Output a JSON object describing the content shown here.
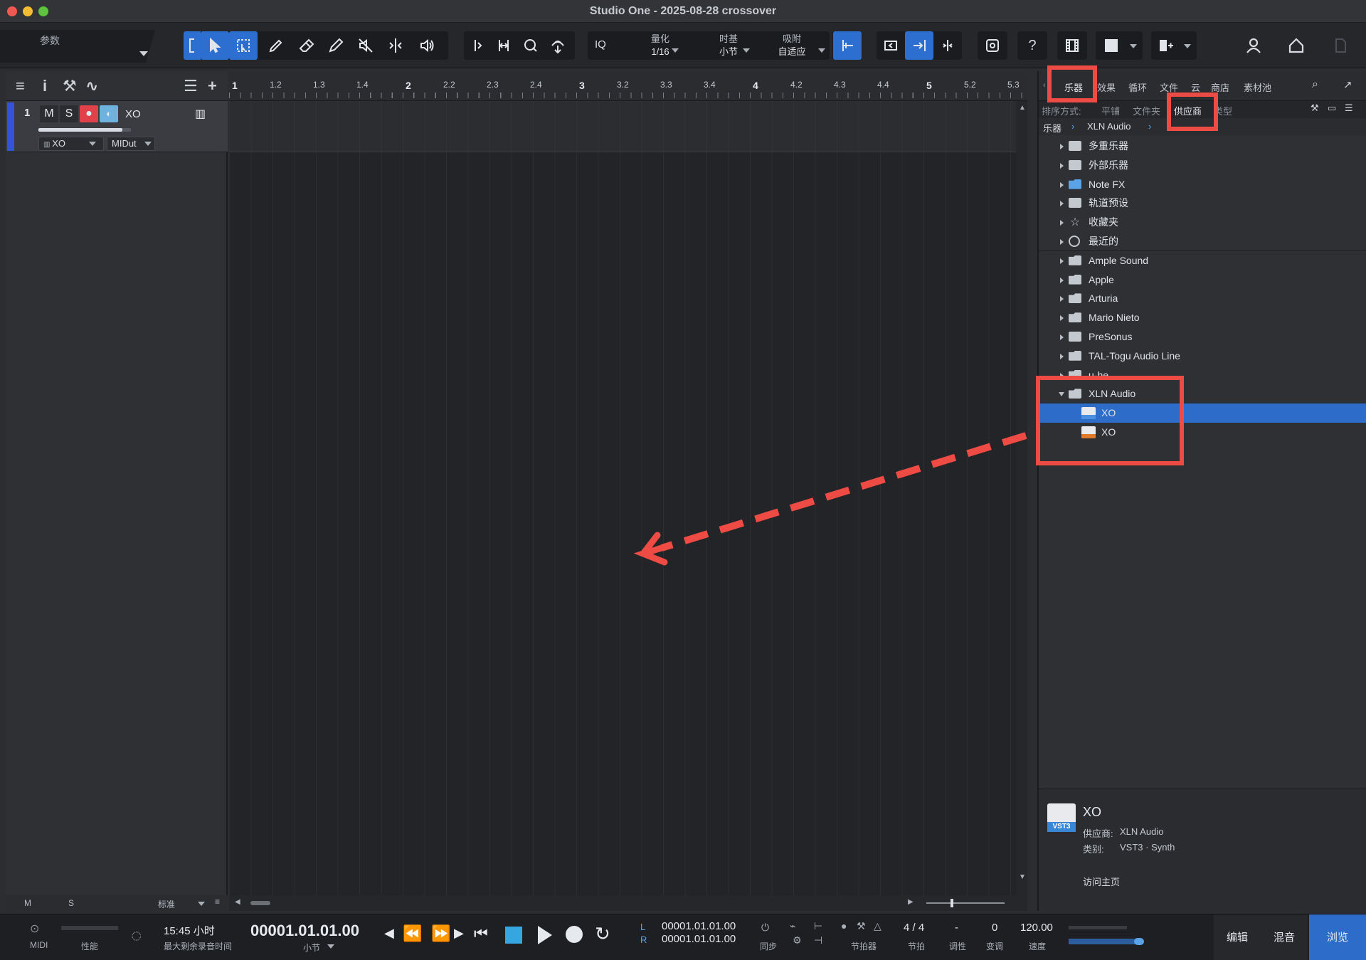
{
  "window": {
    "title": "Studio One - 2025-08-28 crossover"
  },
  "toolbar": {
    "params_label": "参数",
    "quantize": {
      "label": "量化",
      "value": "1/16"
    },
    "timebase": {
      "label": "时基",
      "value": "小节"
    },
    "snap": {
      "label": "吸附",
      "value": "自适应"
    },
    "iq_label": "IQ",
    "help_label": "?"
  },
  "ruler": {
    "labels": [
      "1",
      "1.2",
      "1.3",
      "1.4",
      "2",
      "2.2",
      "2.3",
      "2.4",
      "3",
      "3.2",
      "3.3",
      "3.4",
      "4",
      "4.2",
      "4.3",
      "4.4",
      "5",
      "5.2",
      "5.3"
    ]
  },
  "track": {
    "number": "1",
    "mute": "M",
    "solo": "S",
    "name": "XO",
    "instrument": "XO",
    "midi": "MIDut"
  },
  "track_footer": {
    "m": "M",
    "s": "S",
    "mode": "标准"
  },
  "browser": {
    "tabs": [
      "乐器",
      "效果",
      "循环",
      "文件",
      "云",
      "商店",
      "素材池"
    ],
    "sort_label": "排序方式:",
    "sort_options": [
      "平铺",
      "文件夹",
      "供应商",
      "类型"
    ],
    "breadcrumb": [
      "乐器",
      "XLN Audio"
    ],
    "tree": [
      {
        "label": "多重乐器",
        "icon": "multi-instrument-icon"
      },
      {
        "label": "外部乐器",
        "icon": "external-instrument-icon"
      },
      {
        "label": "Note FX",
        "icon": "note-fx-icon"
      },
      {
        "label": "轨道预设",
        "icon": "track-preset-icon"
      },
      {
        "label": "收藏夹",
        "icon": "star-icon"
      },
      {
        "label": "最近的",
        "icon": "clock-icon"
      },
      {
        "label": "Ample Sound",
        "icon": "folder-icon"
      },
      {
        "label": "Apple",
        "icon": "folder-icon"
      },
      {
        "label": "Arturia",
        "icon": "folder-icon"
      },
      {
        "label": "Mario Nieto",
        "icon": "folder-icon"
      },
      {
        "label": "PreSonus",
        "icon": "presonus-icon"
      },
      {
        "label": "TAL-Togu Audio Line",
        "icon": "folder-icon"
      },
      {
        "label": "u-he",
        "icon": "folder-icon"
      },
      {
        "label": "XLN Audio",
        "icon": "folder-open-icon"
      }
    ],
    "children": [
      {
        "label": "XO",
        "format": "VST3",
        "selected": true
      },
      {
        "label": "XO",
        "format": "AU",
        "selected": false
      }
    ],
    "info": {
      "name": "XO",
      "vendor_label": "供应商:",
      "vendor": "XLN Audio",
      "category_label": "类别:",
      "category": "VST3 · Synth",
      "homepage": "访问主页",
      "badge": "VST3"
    }
  },
  "transport": {
    "midi_label": "MIDI",
    "perf_label": "性能",
    "record_time": "15:45 小时",
    "record_time_label": "最大剩余录音时间",
    "position": "00001.01.01.00",
    "position_unit": "小节",
    "loop_l_label": "L",
    "loop_r_label": "R",
    "loop_l": "00001.01.01.00",
    "loop_r": "00001.01.01.00",
    "sync_label": "同步",
    "metronome_label": "节拍器",
    "signature": "4 / 4",
    "signature_label": "节拍",
    "key": "-",
    "key_label": "调性",
    "transpose": "0",
    "transpose_label": "变调",
    "tempo": "120.00",
    "tempo_label": "速度"
  },
  "pages": {
    "edit": "编辑",
    "mix": "混音",
    "browse": "浏览"
  },
  "colors": {
    "accent": "#2d6dc9",
    "highlight": "#ee4b44",
    "record": "#e1424a"
  }
}
